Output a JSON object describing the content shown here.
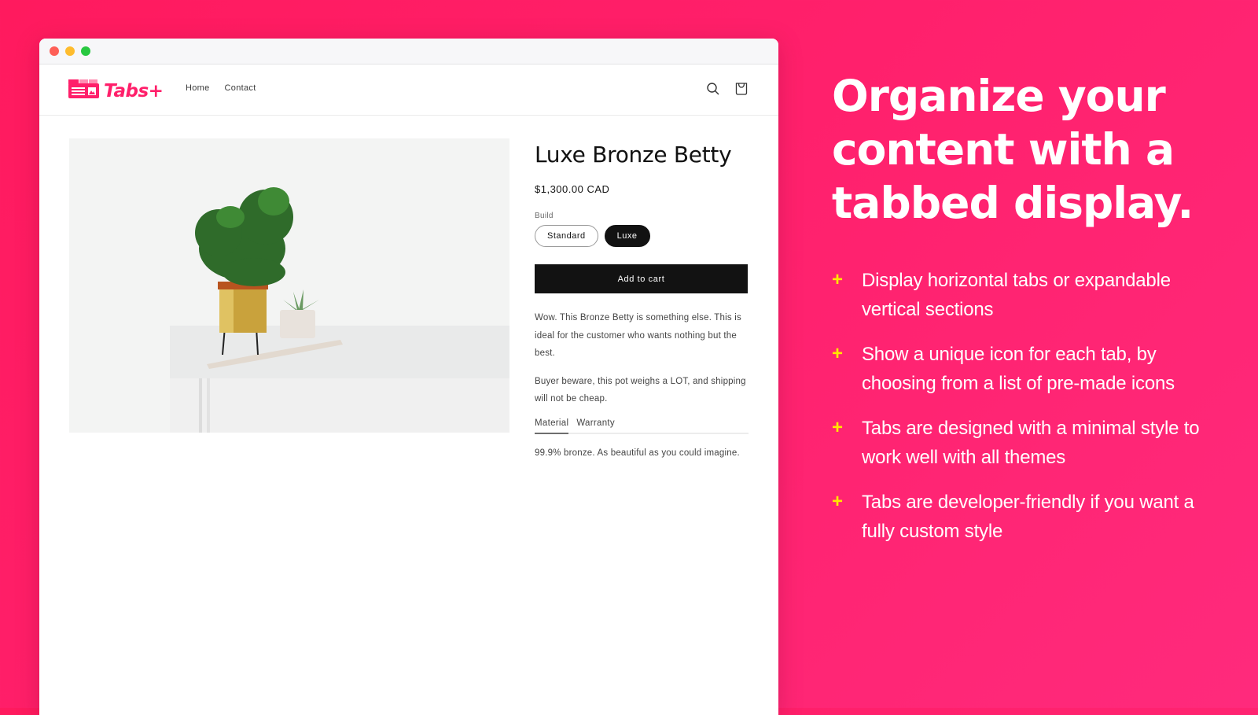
{
  "browser": {
    "window_controls": [
      "close",
      "minimize",
      "maximize"
    ]
  },
  "store": {
    "logo_text": "Tabs+",
    "logo_icon": "tabs-browser-icon",
    "nav": [
      {
        "label": "Home"
      },
      {
        "label": "Contact"
      }
    ],
    "icons": [
      "search-icon",
      "cart-bag-icon"
    ]
  },
  "product": {
    "image_alt": "Plant in gold pot on white table",
    "title": "Luxe Bronze Betty",
    "price": "$1,300.00 CAD",
    "option_label": "Build",
    "options": [
      {
        "label": "Standard",
        "selected": false
      },
      {
        "label": "Luxe",
        "selected": true
      }
    ],
    "add_to_cart_label": "Add to cart",
    "description": [
      "Wow. This Bronze Betty is something else. This is ideal for the customer who wants nothing but the best.",
      "Buyer beware, this pot weighs a LOT, and shipping will not be cheap."
    ],
    "tabs": [
      {
        "label": "Material",
        "active": true
      },
      {
        "label": "Warranty",
        "active": false
      }
    ],
    "tab_content": "99.9% bronze. As beautiful as you could imagine."
  },
  "marketing": {
    "headline": "Organize your content with a tabbed display.",
    "bullet_symbol": "+",
    "features": [
      "Display horizontal tabs or expandable vertical sections",
      "Show a unique icon for each tab, by choosing from a list of pre-made icons",
      "Tabs are designed with a minimal style to work well with all themes",
      "Tabs are developer-friendly if you want a fully custom style"
    ]
  },
  "colors": {
    "brand_pink": "#ff1f6a",
    "accent_yellow": "#ffe600",
    "button_black": "#121212"
  }
}
